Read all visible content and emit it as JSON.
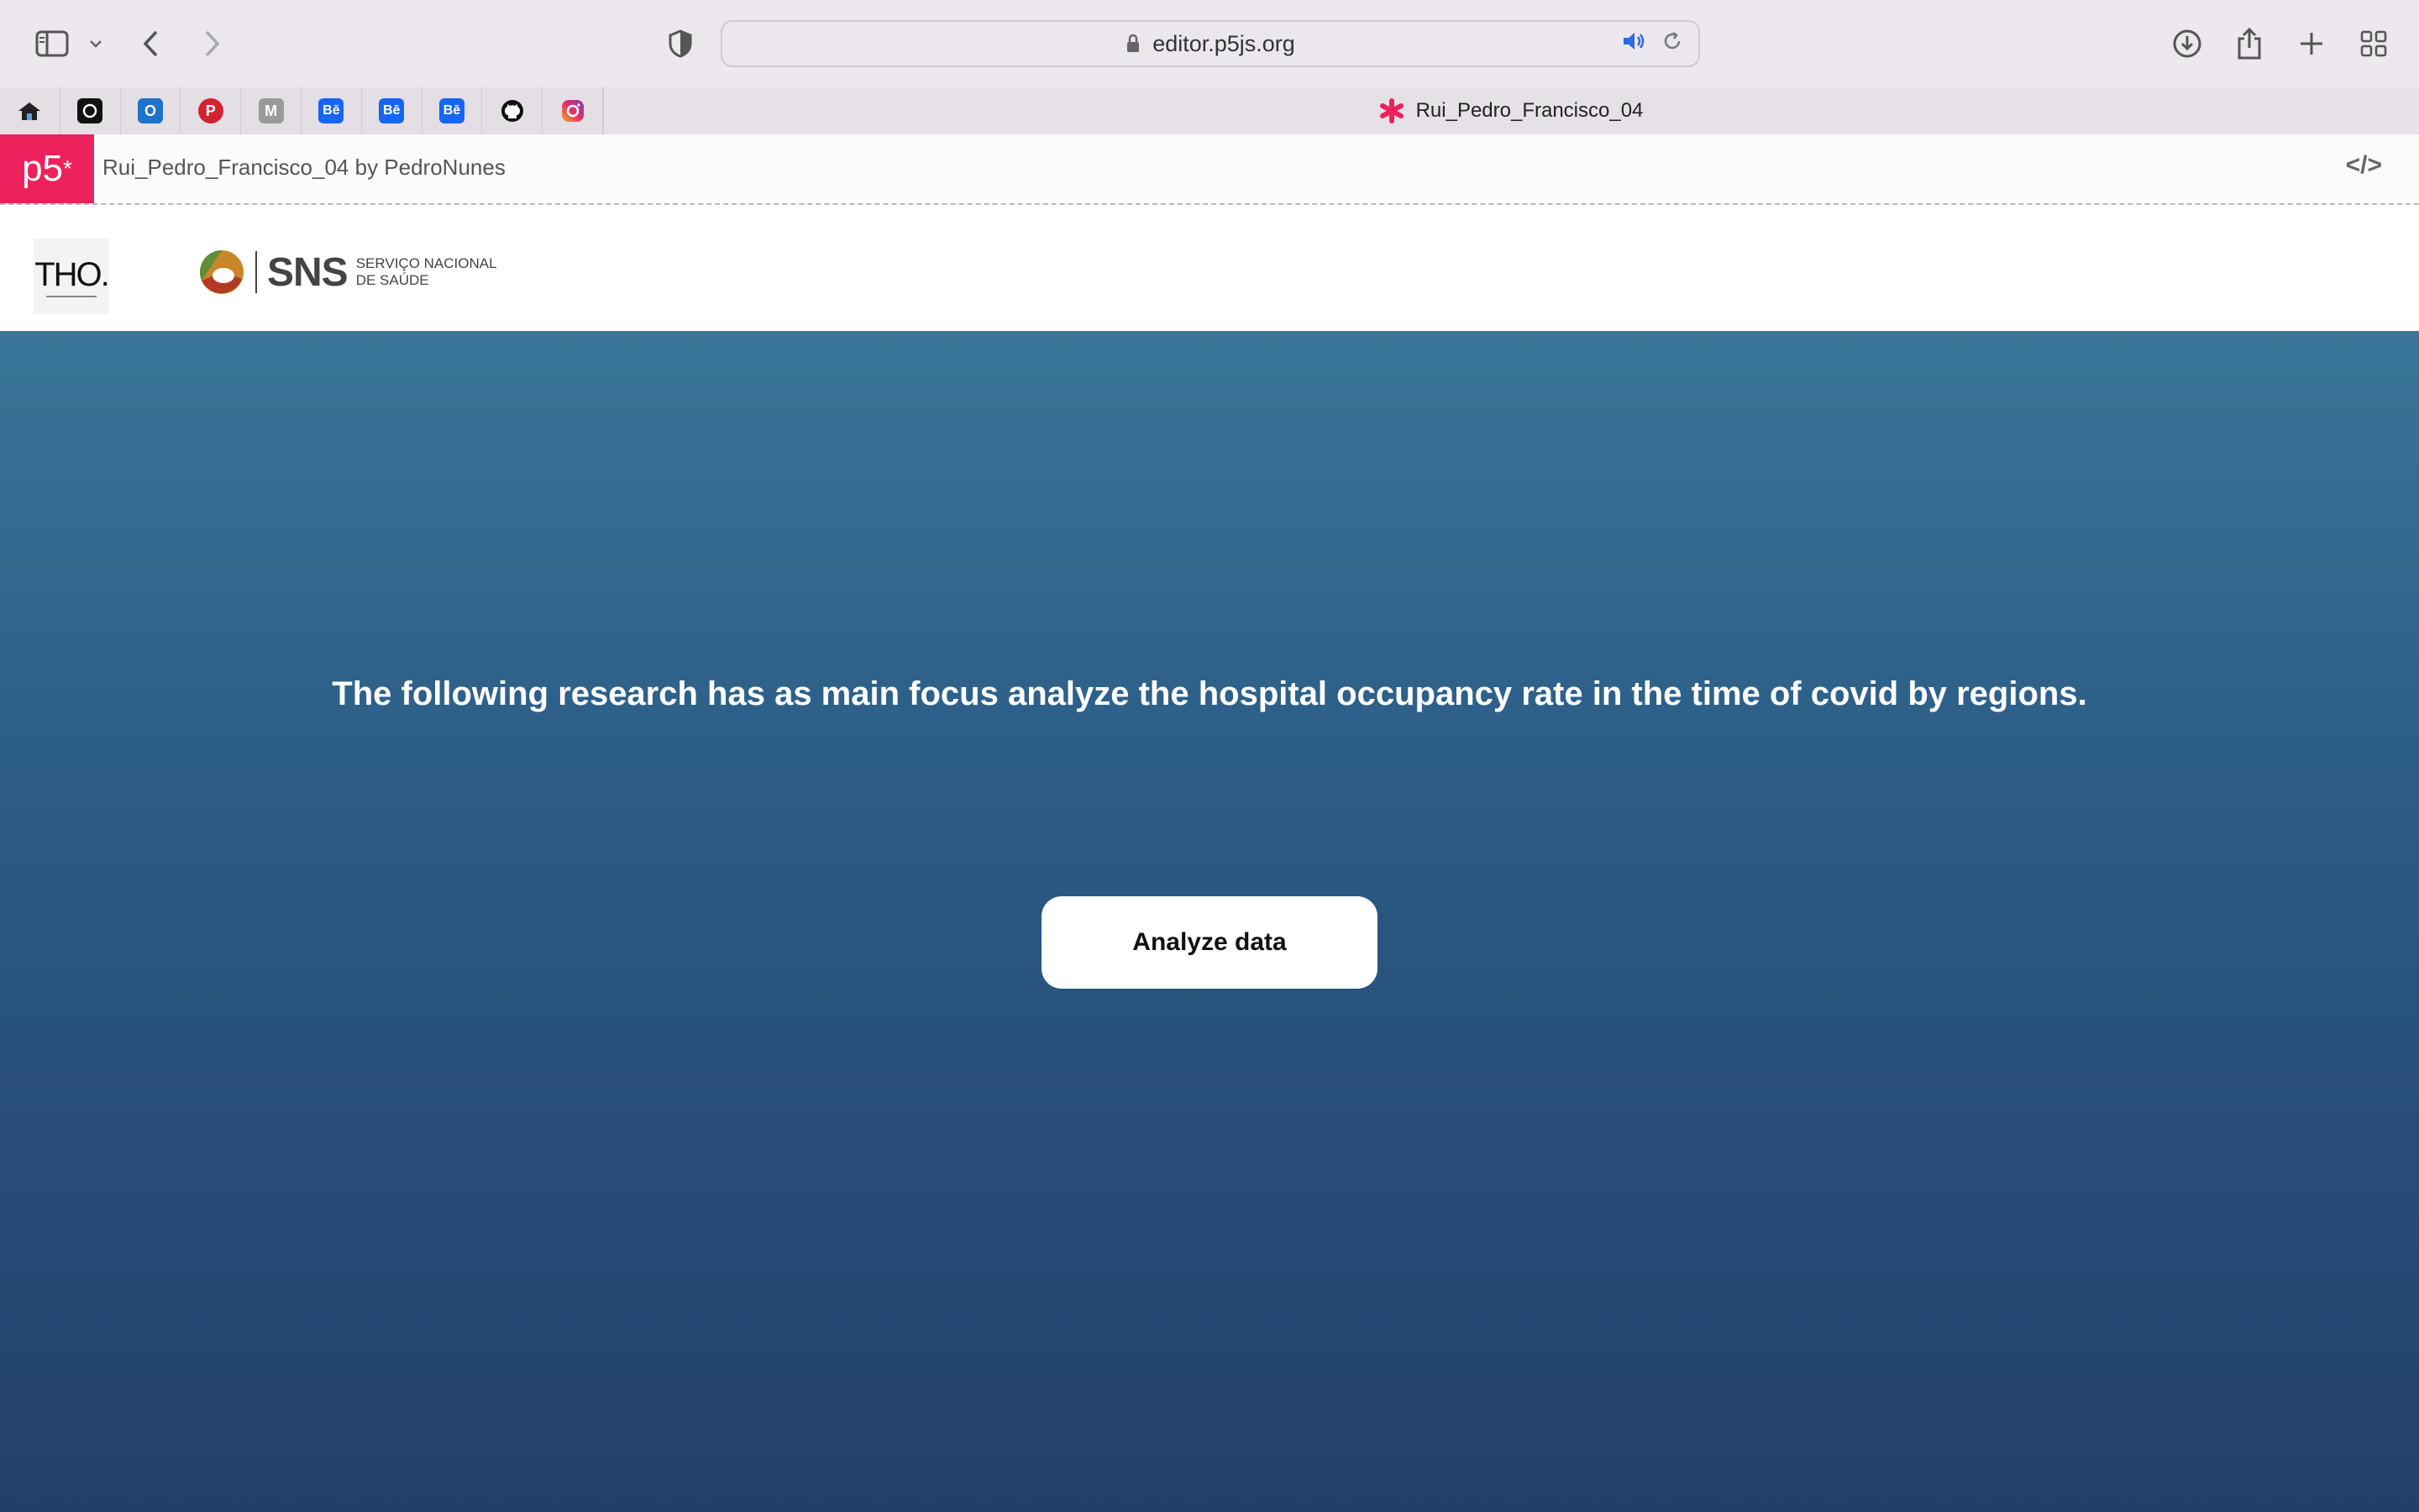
{
  "browser": {
    "url": "editor.p5js.org",
    "active_tab_title": "Rui_Pedro_Francisco_04",
    "favorites": [
      {
        "name": "home",
        "label": ""
      },
      {
        "name": "circle-app",
        "label": ""
      },
      {
        "name": "outlook",
        "label": "O"
      },
      {
        "name": "pinterest",
        "label": "P"
      },
      {
        "name": "medium",
        "label": "M"
      },
      {
        "name": "behance-1",
        "label": "Bē"
      },
      {
        "name": "behance-2",
        "label": "Bē"
      },
      {
        "name": "behance-3",
        "label": "Bē"
      },
      {
        "name": "github",
        "label": ""
      },
      {
        "name": "instagram",
        "label": ""
      }
    ]
  },
  "p5": {
    "logo": "p5",
    "logo_star": "*",
    "sketch_title": "Rui_Pedro_Francisco_04 by PedroNunes",
    "code_icon": "</>"
  },
  "sketch": {
    "tho_logo": "THO.",
    "sns_logo": "SNS",
    "sns_line1": "SERVIÇO NACIONAL",
    "sns_line2": "DE SAÚDE",
    "intro_text": "The following research has as main focus analyze the hospital occupancy rate in the time of covid by regions.",
    "button_label": "Analyze data"
  },
  "colors": {
    "p5_pink": "#ed225d",
    "hero_top": "#397698",
    "hero_bottom": "#223f6a"
  }
}
